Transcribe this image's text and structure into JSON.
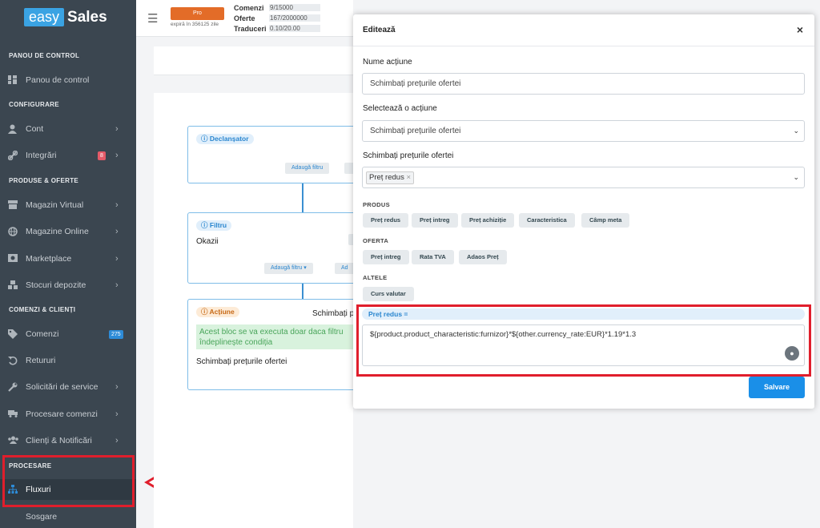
{
  "logo": {
    "easy": "easy",
    "sales": "Sales"
  },
  "sidebar": {
    "sections": {
      "panou": "PANOU DE CONTROL",
      "configurare": "CONFIGURARE",
      "produse": "PRODUSE & OFERTE",
      "comenzi": "COMENZI & CLIENȚI",
      "procesare": "PROCESARE"
    },
    "items": {
      "panou": "Panou de control",
      "cont": "Cont",
      "integrari": "Integrări",
      "integrari_badge": "8",
      "magazin_virtual": "Magazin Virtual",
      "magazine_online": "Magazine Online",
      "marketplace": "Marketplace",
      "stocuri": "Stocuri depozite",
      "comenzi": "Comenzi",
      "comenzi_badge": "275",
      "retururi": "Retururi",
      "solicitari": "Solicitări de service",
      "procesare_comenzi": "Procesare comenzi",
      "clienti": "Clienți & Notificări",
      "fluxuri": "Fluxuri",
      "cut": "Sosgare"
    }
  },
  "topbar": {
    "plan": "Pro",
    "expira": "expiră în 356125 zile",
    "comenzi_label": "Comenzi",
    "comenzi_value": "9/15000",
    "oferte_label": "Oferte",
    "oferte_value": "167/2000000",
    "traduceri_label": "Traduceri",
    "traduceri_value": "0.10/20.00"
  },
  "flow": {
    "declansator": "Declanșator",
    "adauga_filtru": "Adaugă filtru",
    "filtru": "Filtru",
    "okazii": "Okazii",
    "adauga_filtru2": "Adaugă filtru",
    "adauga_short": "Ad",
    "actiune": "Acțiune",
    "schimbati_short": "Schimbați p",
    "green_text": "Acest bloc se va executa doar daca filtru îndeplinește condiția",
    "schimbati_full": "Schimbați prețurile ofertei"
  },
  "modal": {
    "title": "Editează",
    "close": "×",
    "nume_label": "Nume acțiune",
    "nume_value": "Schimbați prețurile ofertei",
    "select_label": "Selectează o acțiune",
    "select_value": "Schimbați prețurile ofertei",
    "schimbati_label": "Schimbați prețurile ofertei",
    "chip": "Preț redus",
    "produs_label": "PRODUS",
    "produs_pills": [
      "Preț redus",
      "Preț intreg",
      "Preț achiziție",
      "Caracteristica",
      "Câmp meta"
    ],
    "oferta_label": "OFERTA",
    "oferta_pills": [
      "Preț intreg",
      "Rata TVA",
      "Adaos Preț"
    ],
    "altele_label": "ALTELE",
    "altele_pills": [
      "Curs valutar"
    ],
    "formula_label": "Preț redus =",
    "formula": "${product.product_characteristic:furnizor}*${other.currency_rate:EUR}*1.19*1.3",
    "save": "Salvare"
  }
}
